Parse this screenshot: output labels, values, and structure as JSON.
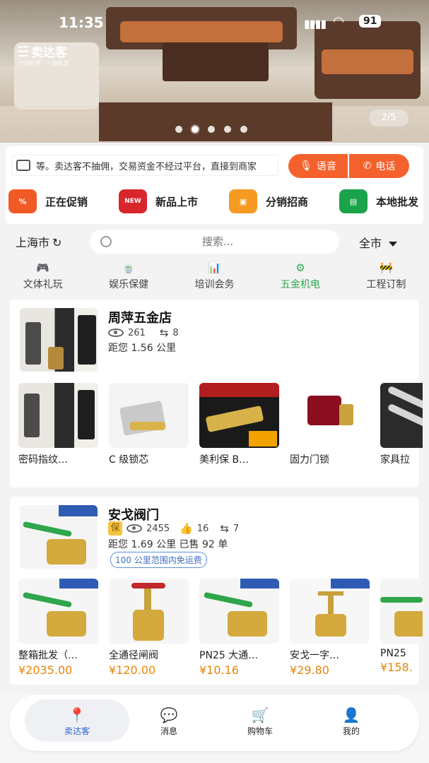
{
  "status_bar": {
    "time": "11:35",
    "battery": "91",
    "signal": "▮▮▮▮",
    "wifi": "◠"
  },
  "banner": {
    "logo_text": "卖达客",
    "logo_sub": "全国经营 · 一站批发",
    "page_indicator": "2/5",
    "dots": 5,
    "active_dot": 1
  },
  "notice": {
    "text": "等。卖达客不抽佣，交易资金不经过平台，直接到商家",
    "voice_label": "语音",
    "phone_label": "电话"
  },
  "categories": [
    {
      "label": "正在促销",
      "icon": "promo-icon",
      "color": "#f15a24",
      "glyph": "%"
    },
    {
      "label": "新品上市",
      "icon": "new-icon",
      "color": "#d9262b",
      "glyph": "NEW"
    },
    {
      "label": "分销招商",
      "icon": "bag-icon",
      "color": "#f59a23",
      "glyph": "▣"
    },
    {
      "label": "本地批发",
      "icon": "truck-icon",
      "color": "#1aa34a",
      "glyph": "▤"
    }
  ],
  "filter": {
    "city": "上海市",
    "search_placeholder": "搜索...",
    "scope": "全市"
  },
  "subcategories": [
    {
      "label": "文体礼玩",
      "icon": "gamepad-icon",
      "glyph": "🎮",
      "active": false
    },
    {
      "label": "娱乐保健",
      "icon": "tea-icon",
      "glyph": "🍵",
      "active": false
    },
    {
      "label": "培训会务",
      "icon": "chart-icon",
      "glyph": "📊",
      "active": false
    },
    {
      "label": "五金机电",
      "icon": "gear-icon",
      "glyph": "⚙",
      "active": true
    },
    {
      "label": "工程订制",
      "icon": "barrier-icon",
      "glyph": "🚧",
      "active": false
    }
  ],
  "shops": [
    {
      "name": "周萍五金店",
      "views": "261",
      "shares": "8",
      "distance": "距您 1.56 公里",
      "products": [
        {
          "name": "密码指纹…",
          "price": ""
        },
        {
          "name": "C 级锁芯",
          "price": ""
        },
        {
          "name": "美利保 B…",
          "price": ""
        },
        {
          "name": "固力门锁",
          "price": ""
        },
        {
          "name": "家具拉",
          "price": ""
        }
      ]
    },
    {
      "name": "安戈阀门",
      "badge": "保",
      "views": "2455",
      "likes": "16",
      "shares": "7",
      "distance": "距您 1.69 公里  已售 92 单",
      "free_shipping": "100 公里范围内免运费",
      "products": [
        {
          "name": "整箱批发（…",
          "price": "¥2035.00"
        },
        {
          "name": "全通径闸阀",
          "price": "¥120.00"
        },
        {
          "name": "PN25 大通…",
          "price": "¥10.16"
        },
        {
          "name": "安戈一字…",
          "price": "¥29.80"
        },
        {
          "name": "PN25",
          "price": "¥158."
        }
      ]
    }
  ],
  "tabbar": [
    {
      "label": "卖达客",
      "icon": "location-pin-icon",
      "active": true
    },
    {
      "label": "消息",
      "icon": "chat-bubble-icon",
      "active": false
    },
    {
      "label": "购物车",
      "icon": "cart-icon",
      "active": false
    },
    {
      "label": "我的",
      "icon": "user-icon",
      "active": false
    }
  ],
  "colors": {
    "accent": "#f5612d",
    "price": "#e8840b",
    "active_tab": "#2f66d1",
    "active_subcat": "#2fa84f"
  }
}
